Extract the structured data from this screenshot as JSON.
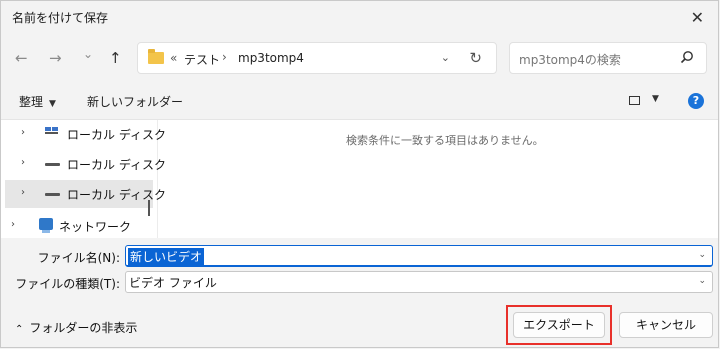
{
  "window": {
    "title": "名前を付けて保存",
    "close_glyph": "✕"
  },
  "nav": {
    "back_glyph": "←",
    "forward_glyph": "→",
    "recent_glyph": "⌄",
    "up_glyph": "↑",
    "breadcrumb": {
      "overflow": "«",
      "items": [
        "テスト",
        "mp3tomp4"
      ],
      "sep": "›"
    },
    "address_dropdown_glyph": "⌄",
    "refresh_glyph": "↻",
    "search_placeholder": "mp3tomp4の検索"
  },
  "toolbar": {
    "organize": "整理",
    "organize_caret": "▼",
    "new_folder": "新しいフォルダー",
    "view_caret": "▼",
    "help": "?"
  },
  "tree": {
    "chevron": "›",
    "items": [
      {
        "label": "ローカル ディスク"
      },
      {
        "label": "ローカル ディスク"
      },
      {
        "label": "ローカル ディスク"
      },
      {
        "label": "ネットワーク"
      }
    ]
  },
  "content": {
    "empty_message": "検索条件に一致する項目はありません。"
  },
  "form": {
    "filename_label": "ファイル名(N):",
    "filename_value": "新しいビデオ",
    "filetype_label": "ファイルの種類(T):",
    "filetype_value": "ビデオ ファイル",
    "dropdown_glyph": "⌄"
  },
  "footer": {
    "hide_caret": "⌃",
    "hide_folders": "フォルダーの非表示",
    "export_button": "エクスポート",
    "cancel_button": "キャンセル"
  },
  "colors": {
    "accent": "#0a64d4",
    "highlight": "#e8302a",
    "folder": "#f3c44a"
  }
}
